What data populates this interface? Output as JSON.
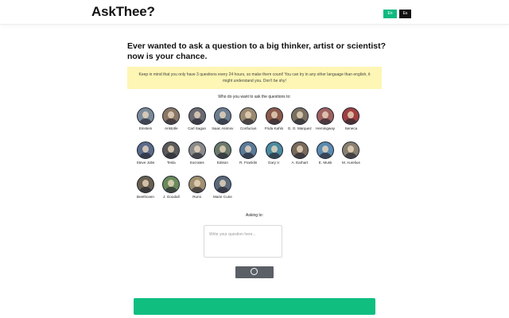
{
  "header": {
    "logo": "AskThee?",
    "languages": [
      {
        "label": "En",
        "active": true
      },
      {
        "label": "Es",
        "active": false
      }
    ]
  },
  "main": {
    "headline": "Ever wanted to ask a question to a big thinker, artist or scientist? now is your chance.",
    "notice": "Keep in mind that you only have 3 questions every 24 hours, so make them count!  You can try in any other language than english, it might understand you. Don't be shy!",
    "prompt": "Who do you want to ask the questions to:",
    "thinkers": [
      {
        "name": "Einstein",
        "color": "#7a8a9a"
      },
      {
        "name": "Aristotle",
        "color": "#8a7766"
      },
      {
        "name": "Carl Sagan",
        "color": "#6a6a72"
      },
      {
        "name": "Isaac Asimov",
        "color": "#6b7d8f"
      },
      {
        "name": "Confucius",
        "color": "#9a8a70"
      },
      {
        "name": "Frida Kahlo",
        "color": "#8a5a4a"
      },
      {
        "name": "G. G. Marquez",
        "color": "#7a7060"
      },
      {
        "name": "Hemingway",
        "color": "#a06060"
      },
      {
        "name": "Seneca",
        "color": "#a04040"
      },
      {
        "name": "Steve Jobs",
        "color": "#5a6a8a"
      },
      {
        "name": "Tesla",
        "color": "#5a5a5a"
      },
      {
        "name": "Socrates",
        "color": "#8a8a8a"
      },
      {
        "name": "Edison",
        "color": "#6a7a6a"
      },
      {
        "name": "R. Franklin",
        "color": "#5a7a9a"
      },
      {
        "name": "Gary V.",
        "color": "#4a8aa0"
      },
      {
        "name": "A. Earhart",
        "color": "#7a6a5a"
      },
      {
        "name": "E. Musk",
        "color": "#5a8ab0"
      },
      {
        "name": "M. Aurelius",
        "color": "#8a8070"
      },
      {
        "name": "Beethoven",
        "color": "#6a6050"
      },
      {
        "name": "J. Goodall",
        "color": "#6a8a5a"
      },
      {
        "name": "Rumi",
        "color": "#a09070"
      },
      {
        "name": "Marie Curie",
        "color": "#5a6a7a"
      }
    ],
    "asking_label": "Asking to:",
    "question_placeholder": "Write your question here..."
  },
  "colors": {
    "accent": "#10be80",
    "notice_bg": "#fdf6b4",
    "send_button": "#5b5f66"
  }
}
